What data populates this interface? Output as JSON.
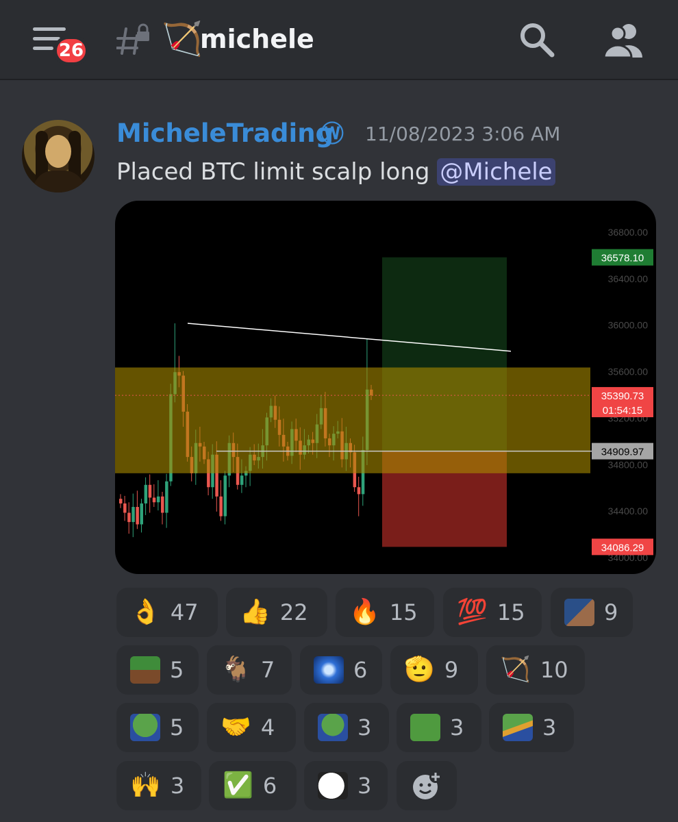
{
  "header": {
    "unread_count": "26",
    "channel_emoji": "🏹",
    "channel_name": "michele",
    "icons": [
      "hamburger-menu-icon",
      "locked-channel-icon",
      "search-icon",
      "members-icon"
    ]
  },
  "message": {
    "username": "MicheleTrading",
    "role_icon": "Ⓦ",
    "timestamp": "11/08/2023 3:06 AM",
    "text": "Placed BTC limit scalp long ",
    "mention": "@Michele",
    "username_color": "#3a8cd8"
  },
  "chart_data": {
    "type": "candlestick",
    "y_ticks": [
      "36800.00",
      "36400.00",
      "36000.00",
      "35600.00",
      "35200.00",
      "34800.00",
      "34400.00",
      "34000.00"
    ],
    "ylim": [
      34000,
      36800
    ],
    "take_profit_label": "36578.10",
    "current_price_label": "35390.73",
    "countdown": "01:54:15",
    "entry_label": "34909.97",
    "stop_loss_label": "34086.29",
    "take_profit": 36578.1,
    "current_price": 35390.73,
    "entry": 34909.97,
    "stop_loss": 34086.29,
    "zone_high": 35630,
    "zone_low": 34720,
    "colors": {
      "up": "#2fa27a",
      "down": "#e9574f",
      "zone": "#7a6200",
      "profit": "#0d2a11",
      "loss": "#7a1e1a",
      "tp_label": "#1f7d33",
      "sl_label": "#f04545",
      "entry_label": "#a5a5a5"
    }
  },
  "reactions": [
    {
      "emoji": "👌",
      "count": "47"
    },
    {
      "emoji": "👍",
      "count": "22"
    },
    {
      "emoji": "🔥",
      "count": "15"
    },
    {
      "emoji": "💯",
      "count": "15"
    },
    {
      "emoji": "hug-custom-emoji",
      "count": "9"
    },
    {
      "emoji": "pepe-laying-custom-emoji",
      "count": "5"
    },
    {
      "emoji": "🐐",
      "count": "7"
    },
    {
      "emoji": "galaxy-brain-custom-emoji",
      "count": "6"
    },
    {
      "emoji": "🫡",
      "count": "9"
    },
    {
      "emoji": "🏹",
      "count": "10"
    },
    {
      "emoji": "pepe-custom-emoji",
      "count": "5"
    },
    {
      "emoji": "🤝",
      "count": "4"
    },
    {
      "emoji": "pepe-tie-custom-emoji",
      "count": "3"
    },
    {
      "emoji": "pepe-smirk-custom-emoji",
      "count": "3"
    },
    {
      "emoji": "pepe-bird-custom-emoji",
      "count": "3"
    },
    {
      "emoji": "🙌",
      "count": "3"
    },
    {
      "emoji": "✅",
      "count": "6"
    },
    {
      "emoji": "ghost-face-custom-emoji",
      "count": "3"
    }
  ],
  "add_reaction_icon": "add-reaction-icon"
}
